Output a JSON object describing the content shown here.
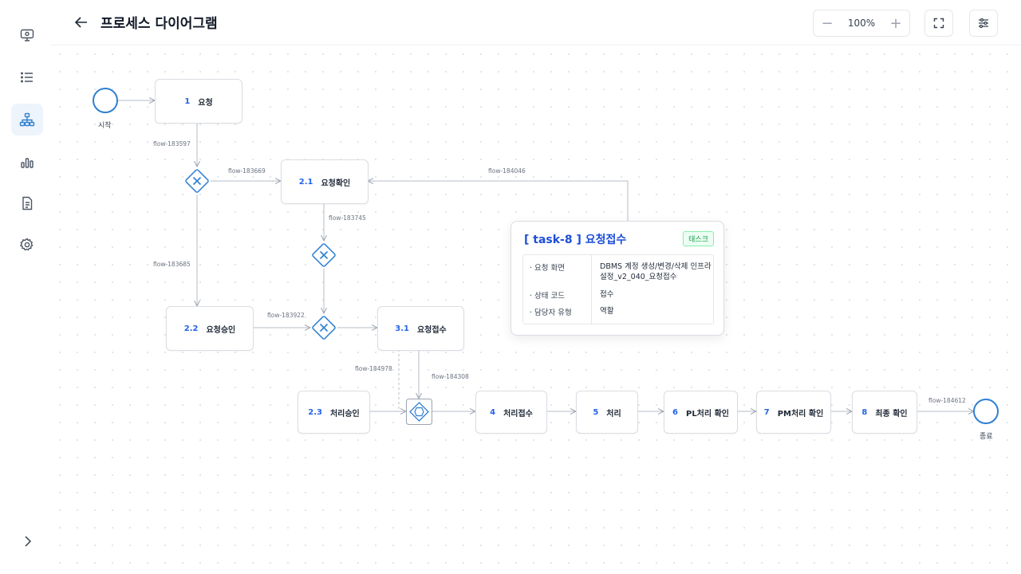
{
  "header": {
    "title": "프로세스 다이어그램",
    "zoom": "100%",
    "zoom_out": "−",
    "zoom_in": "+"
  },
  "sidebar": {
    "items": [
      {
        "icon": "monitor-icon"
      },
      {
        "icon": "list-icon"
      },
      {
        "icon": "hierarchy-icon",
        "active": true
      },
      {
        "icon": "bar-chart-icon"
      },
      {
        "icon": "document-icon"
      },
      {
        "icon": "gear-icon"
      }
    ]
  },
  "events": {
    "start": "시작",
    "end": "종료"
  },
  "nodes": [
    {
      "num": "1",
      "label": "요청"
    },
    {
      "num": "2.1",
      "label": "요청확인"
    },
    {
      "num": "2.2",
      "label": "요청승인"
    },
    {
      "num": "3.1",
      "label": "요청접수"
    },
    {
      "num": "2.3",
      "label": "처리승인"
    },
    {
      "num": "4",
      "label": "처리접수"
    },
    {
      "num": "5",
      "label": "처리"
    },
    {
      "num": "6",
      "label": "PL처리 확인"
    },
    {
      "num": "7",
      "label": "PM처리 확인"
    },
    {
      "num": "8",
      "label": "최종 확인"
    }
  ],
  "flows": [
    "flow-183597",
    "flow-183669",
    "flow-184046",
    "flow-183745",
    "flow-183685",
    "flow-183922",
    "flow-184978",
    "flow-184308",
    "flow-184612"
  ],
  "popup": {
    "title": "[ task-8 ] 요청접수",
    "badge": "태스크",
    "rows": [
      {
        "key": "요청 화면",
        "value": "DBMS 계정 생성/변경/삭제 인프라 설정_v2_040_요청접수"
      },
      {
        "key": "상태 코드",
        "value": "접수"
      },
      {
        "key": "담당자 유형",
        "value": "역할"
      }
    ]
  },
  "colors": {
    "accent": "#2f80d1",
    "node_number": "#2563eb",
    "badge_green": "#16a34a"
  }
}
